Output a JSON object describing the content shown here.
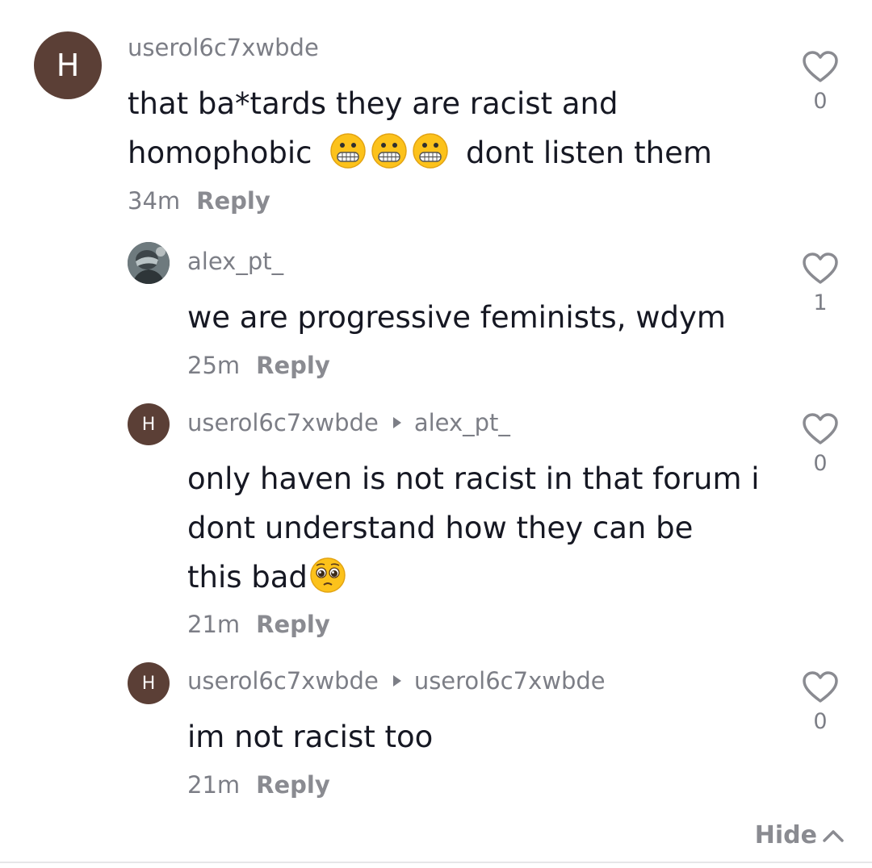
{
  "colors": {
    "avatar_bg": "#5b3f36",
    "username": "#7c7e86",
    "text": "#161823"
  },
  "comments": [
    {
      "avatar_letter": "H",
      "username": "userol6c7xwbde",
      "text_line1": "that ba*tards they are racist and",
      "text_line2_before": "homophobic",
      "text_line2_after": "dont listen them",
      "emoji": "grimacing-face-icon x3",
      "time": "34m",
      "reply_label": "Reply",
      "likes": "0"
    },
    {
      "username": "alex_pt_",
      "text": "we are progressive feminists, wdym",
      "time": "25m",
      "reply_label": "Reply",
      "likes": "1"
    },
    {
      "avatar_letter": "H",
      "username": "userol6c7xwbde",
      "reply_to": "alex_pt_",
      "text_line1": "only haven is not racist in that forum i",
      "text_line2": "dont understand how they can be",
      "text_line3": "this bad",
      "emoji": "pleading-face-icon",
      "time": "21m",
      "reply_label": "Reply",
      "likes": "0"
    },
    {
      "avatar_letter": "H",
      "username": "userol6c7xwbde",
      "reply_to": "userol6c7xwbde",
      "text": "im not racist too",
      "time": "21m",
      "reply_label": "Reply",
      "likes": "0"
    }
  ],
  "hide_label": "Hide"
}
